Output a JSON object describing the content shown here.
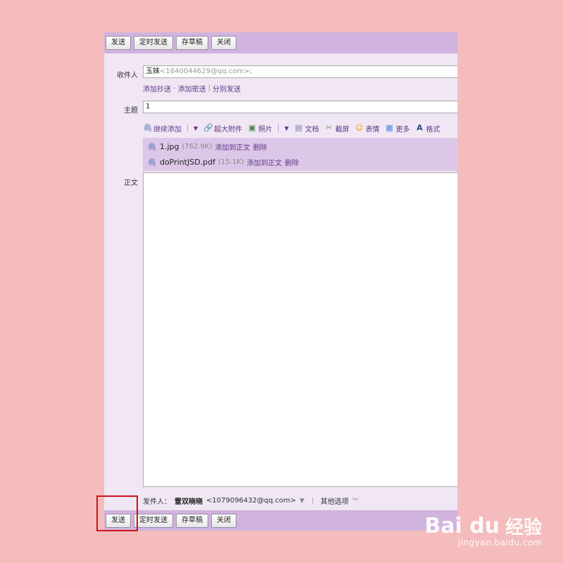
{
  "toolbar": {
    "send": "发送",
    "schedule": "定时发送",
    "draft": "存草稿",
    "close": "关闭"
  },
  "recipient": {
    "label": "收件人",
    "name": "玉妹",
    "email": "<1640044629@qq.com>;"
  },
  "recipient_links": {
    "cc": "添加抄送",
    "dash": "-",
    "bcc": "添加密送",
    "pipe": "|",
    "separate": "分别发送"
  },
  "subject": {
    "label": "主题",
    "value": "1"
  },
  "attach_toolbar": {
    "add": "继续添加",
    "large": "超大附件",
    "photo": "照片",
    "doc": "文档",
    "screenshot": "截屏",
    "emoji": "表情",
    "more": "更多",
    "format": "格式"
  },
  "attachments": [
    {
      "name": "1.jpg",
      "size": "(762.9K)",
      "insert": "添加到正文",
      "delete": "删除"
    },
    {
      "name": "doPrintJSD.pdf",
      "size": "(15.1K)",
      "insert": "添加到正文",
      "delete": "删除"
    }
  ],
  "body": {
    "label": "正文"
  },
  "sender": {
    "label": "发件人：",
    "name": "雷双晓晓",
    "email": "<1079096432@qq.com>",
    "more_options": "其他选项"
  },
  "watermark": {
    "brand": "Bai du",
    "cn": "经验",
    "url": "jingyan.baidu.com"
  },
  "colors": {
    "page_bg": "#f4bcbc",
    "toolbar_bg": "#d1b3df",
    "window_bg": "#f1e6f3",
    "highlight": "#d0121b"
  }
}
